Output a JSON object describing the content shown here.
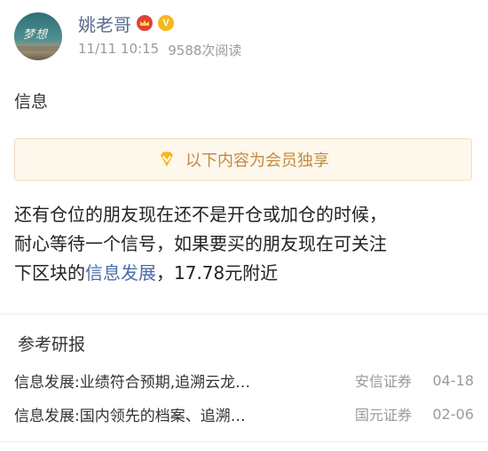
{
  "post": {
    "author": "姚老哥",
    "badge_crown_icon": "crown-icon",
    "badge_v_icon": "v-verified-icon",
    "badge_v_text": "V",
    "timestamp": "11/11 10:15",
    "views": "9588次阅读",
    "section": "信息",
    "member_notice": "以下内容为会员独享",
    "body": {
      "line1": "还有仓位的朋友现在还不是开仓或加仓的时候，",
      "line2": "耐心等待一个信号，如果要买的朋友现在可关注",
      "line3_prefix": "下区块的",
      "stock_link": "信息发展",
      "line3_suffix": "，17.78元附近"
    }
  },
  "research": {
    "title": "参考研报",
    "items": [
      {
        "title": "信息发展:业绩符合预期,追溯云龙…",
        "source": "安信证券",
        "date": "04-18"
      },
      {
        "title": "信息发展:国内领先的档案、追溯…",
        "source": "国元证券",
        "date": "02-06"
      }
    ]
  },
  "colors": {
    "author": "#5a6c8e",
    "link": "#4a6da7",
    "member_bg": "#fdf7ec",
    "member_text": "#c68a3f",
    "crown_bg": "#e0423a",
    "v_bg": "#f5b91c"
  }
}
